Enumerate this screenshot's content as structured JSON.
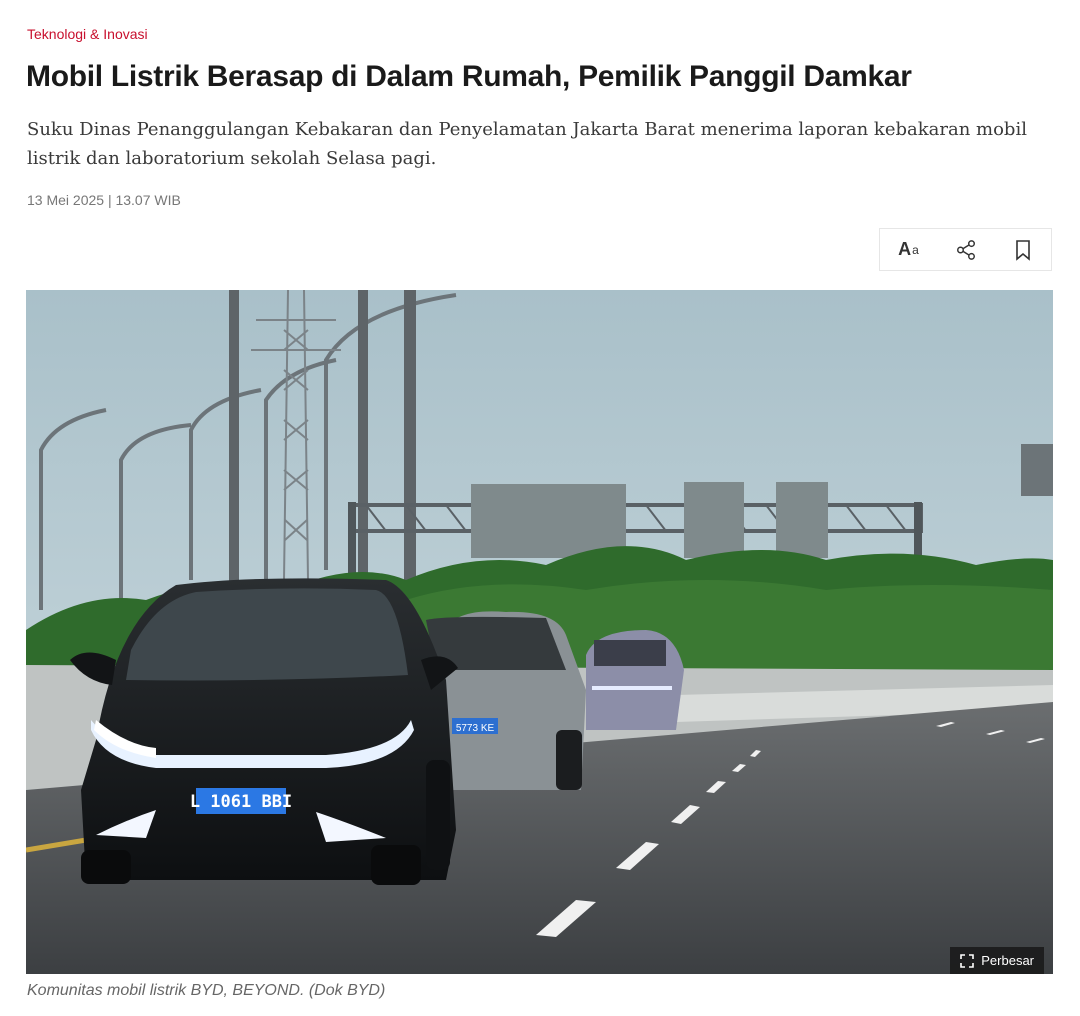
{
  "article": {
    "category": "Teknologi & Inovasi",
    "title": "Mobil Listrik Berasap di Dalam Rumah, Pemilik Panggil Damkar",
    "lede": "Suku Dinas Penanggulangan Kebakaran dan Penyelamatan Jakarta Barat menerima laporan kebakaran mobil listrik dan laboratorium sekolah Selasa pagi.",
    "date": "13 Mei 2025 | 13.07 WIB"
  },
  "toolbar": {
    "font_size_big": "A",
    "font_size_small": "a",
    "share_icon": "share-icon",
    "bookmark_icon": "bookmark-icon"
  },
  "figure": {
    "enlarge_label": "Perbesar",
    "caption": "Komunitas mobil listrik BYD, BEYOND. (Dok BYD)",
    "plate_front": "L 1061 BBI",
    "plate_second": "5773 KE"
  },
  "colors": {
    "category": "#c8102e",
    "sky": "#b7cbd3",
    "foliage": "#2f6b2c",
    "road": "#4a4d50"
  }
}
